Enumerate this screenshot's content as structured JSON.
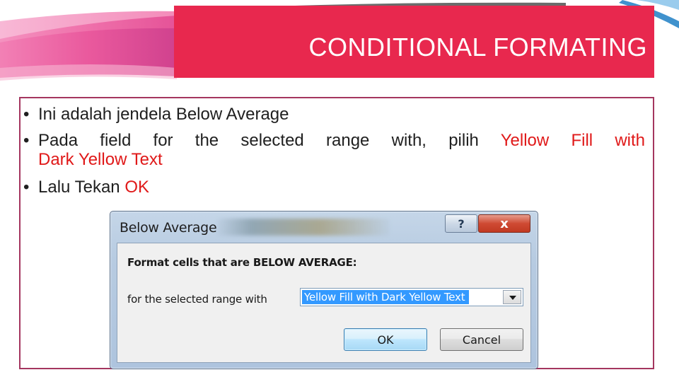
{
  "slide": {
    "title": "CONDITIONAL FORMATING",
    "bullets": [
      {
        "text": "Ini adalah jendela Below Average"
      },
      {
        "text_before": "Pada field for the selected range with, pilih",
        "highlight_line1": "Yellow Fill with",
        "highlight_line2": "Dark Yellow Text"
      },
      {
        "text_before": "Lalu Tekan",
        "highlight": "OK"
      }
    ],
    "colors": {
      "banner": "#e8284e",
      "highlight": "#e01919",
      "frame": "#a4365f"
    }
  },
  "dialog": {
    "title": "Below Average",
    "help_label": "?",
    "close_label": "x",
    "heading": "Format cells that are BELOW AVERAGE:",
    "range_label": "for the selected range with",
    "selected_format": "Yellow Fill with Dark Yellow Text",
    "ok_label": "OK",
    "cancel_label": "Cancel"
  }
}
